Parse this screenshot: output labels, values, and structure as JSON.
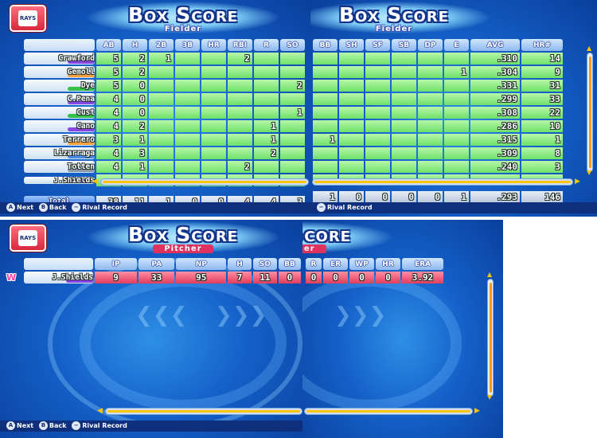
{
  "title": "Box Score",
  "subtitles": {
    "fielder": "Fielder",
    "pitcher": "Pitcher"
  },
  "team_logo_text": "RAYS",
  "footer": {
    "a_key": "A",
    "next": "Next",
    "b_key": "B",
    "back": "Back",
    "minus_key": "−",
    "rival": "Rival Record"
  },
  "batting": {
    "columns_left": [
      "AB",
      "H",
      "2B",
      "3B",
      "HR",
      "RBI",
      "R",
      "SO"
    ],
    "columns_right": [
      "BB",
      "SH",
      "SF",
      "SB",
      "DP",
      "E",
      "AVG",
      "HR#"
    ],
    "total_label": "Total",
    "players": [
      {
        "name": "Crawford",
        "bar": "#8a46e0",
        "AB": "5",
        "H": "2",
        "2B": "1",
        "3B": "",
        "HR": "",
        "RBI": "2",
        "R": "",
        "SO": "",
        "BB": "",
        "SH": "",
        "SF": "",
        "SB": "",
        "DP": "",
        "E": "",
        "AVG": ".310",
        "HRN": "14"
      },
      {
        "name": "Gemoll",
        "bar": "#f7a23c",
        "AB": "5",
        "H": "2",
        "2B": "",
        "3B": "",
        "HR": "",
        "RBI": "",
        "R": "",
        "SO": "",
        "BB": "",
        "SH": "",
        "SF": "",
        "SB": "",
        "DP": "",
        "E": "1",
        "AVG": ".304",
        "HRN": "9"
      },
      {
        "name": "Dye",
        "bar": "#35c24a",
        "AB": "5",
        "H": "0",
        "2B": "",
        "3B": "",
        "HR": "",
        "RBI": "",
        "R": "",
        "SO": "2",
        "BB": "",
        "SH": "",
        "SF": "",
        "SB": "",
        "DP": "",
        "E": "",
        "AVG": ".331",
        "HRN": "31"
      },
      {
        "name": "C.Pena",
        "bar": "#8a46e0",
        "AB": "4",
        "H": "0",
        "2B": "",
        "3B": "",
        "HR": "",
        "RBI": "",
        "R": "",
        "SO": "",
        "BB": "",
        "SH": "",
        "SF": "",
        "SB": "",
        "DP": "",
        "E": "",
        "AVG": ".299",
        "HRN": "33"
      },
      {
        "name": "Cust",
        "bar": "#35c24a",
        "AB": "4",
        "H": "0",
        "2B": "",
        "3B": "",
        "HR": "",
        "RBI": "",
        "R": "",
        "SO": "1",
        "BB": "",
        "SH": "",
        "SF": "",
        "SB": "",
        "DP": "",
        "E": "",
        "AVG": ".308",
        "HRN": "22"
      },
      {
        "name": "Cano",
        "bar": "#8a46e0",
        "AB": "4",
        "H": "2",
        "2B": "",
        "3B": "",
        "HR": "",
        "RBI": "",
        "R": "1",
        "SO": "",
        "BB": "",
        "SH": "",
        "SF": "",
        "SB": "",
        "DP": "",
        "E": "",
        "AVG": ".286",
        "HRN": "10"
      },
      {
        "name": "Terrero",
        "bar": "#f7a23c",
        "AB": "3",
        "H": "1",
        "2B": "",
        "3B": "",
        "HR": "",
        "RBI": "",
        "R": "1",
        "SO": "",
        "BB": "1",
        "SH": "",
        "SF": "",
        "SB": "",
        "DP": "",
        "E": "",
        "AVG": ".315",
        "HRN": "1"
      },
      {
        "name": "Lizarraga",
        "bar": "#4a8de8",
        "AB": "4",
        "H": "3",
        "2B": "",
        "3B": "",
        "HR": "",
        "RBI": "",
        "R": "2",
        "SO": "",
        "BB": "",
        "SH": "",
        "SF": "",
        "SB": "",
        "DP": "",
        "E": "",
        "AVG": ".309",
        "HRN": "8"
      },
      {
        "name": "Totten",
        "bar": "#8d98a6",
        "AB": "4",
        "H": "1",
        "2B": "",
        "3B": "",
        "HR": "",
        "RBI": "2",
        "R": "",
        "SO": "",
        "BB": "",
        "SH": "",
        "SF": "",
        "SB": "",
        "DP": "",
        "E": "",
        "AVG": ".240",
        "HRN": "3"
      },
      {
        "name": "J.Shields",
        "bar": "#8a46e0",
        "AB": "",
        "H": "",
        "2B": "",
        "3B": "",
        "HR": "",
        "RBI": "",
        "R": "",
        "SO": "",
        "BB": "",
        "SH": "",
        "SF": "",
        "SB": "",
        "DP": "",
        "E": "",
        "AVG": "",
        "HRN": ""
      }
    ],
    "totals": {
      "AB": "38",
      "H": "11",
      "2B": "1",
      "3B": "0",
      "HR": "0",
      "RBI": "4",
      "R": "4",
      "SO": "3",
      "BB": "1",
      "SH": "0",
      "SF": "0",
      "SB": "0",
      "DP": "0",
      "E": "1",
      "AVG": ".293",
      "HRN": "146"
    }
  },
  "pitching": {
    "columns_left": [
      "IP",
      "PA",
      "NP",
      "H",
      "SO",
      "BB"
    ],
    "columns_right": [
      "R",
      "ER",
      "WP",
      "HR",
      "ERA"
    ],
    "win_badge": "W",
    "pitcher": {
      "name": "J.Shields",
      "bar": "#8a46e0",
      "IP": "9",
      "PA": "33",
      "NP": "95",
      "H": "7",
      "SO": "11",
      "BB": "0",
      "R": "0",
      "ER": "0",
      "WP": "0",
      "HR": "0",
      "ERA": "3.92"
    }
  },
  "colors": {
    "cell_green": "#6ee06a",
    "pitcher_pink": "#e03d5c",
    "header_blue": "#8fb8ee",
    "title_outline": "#12338a"
  }
}
